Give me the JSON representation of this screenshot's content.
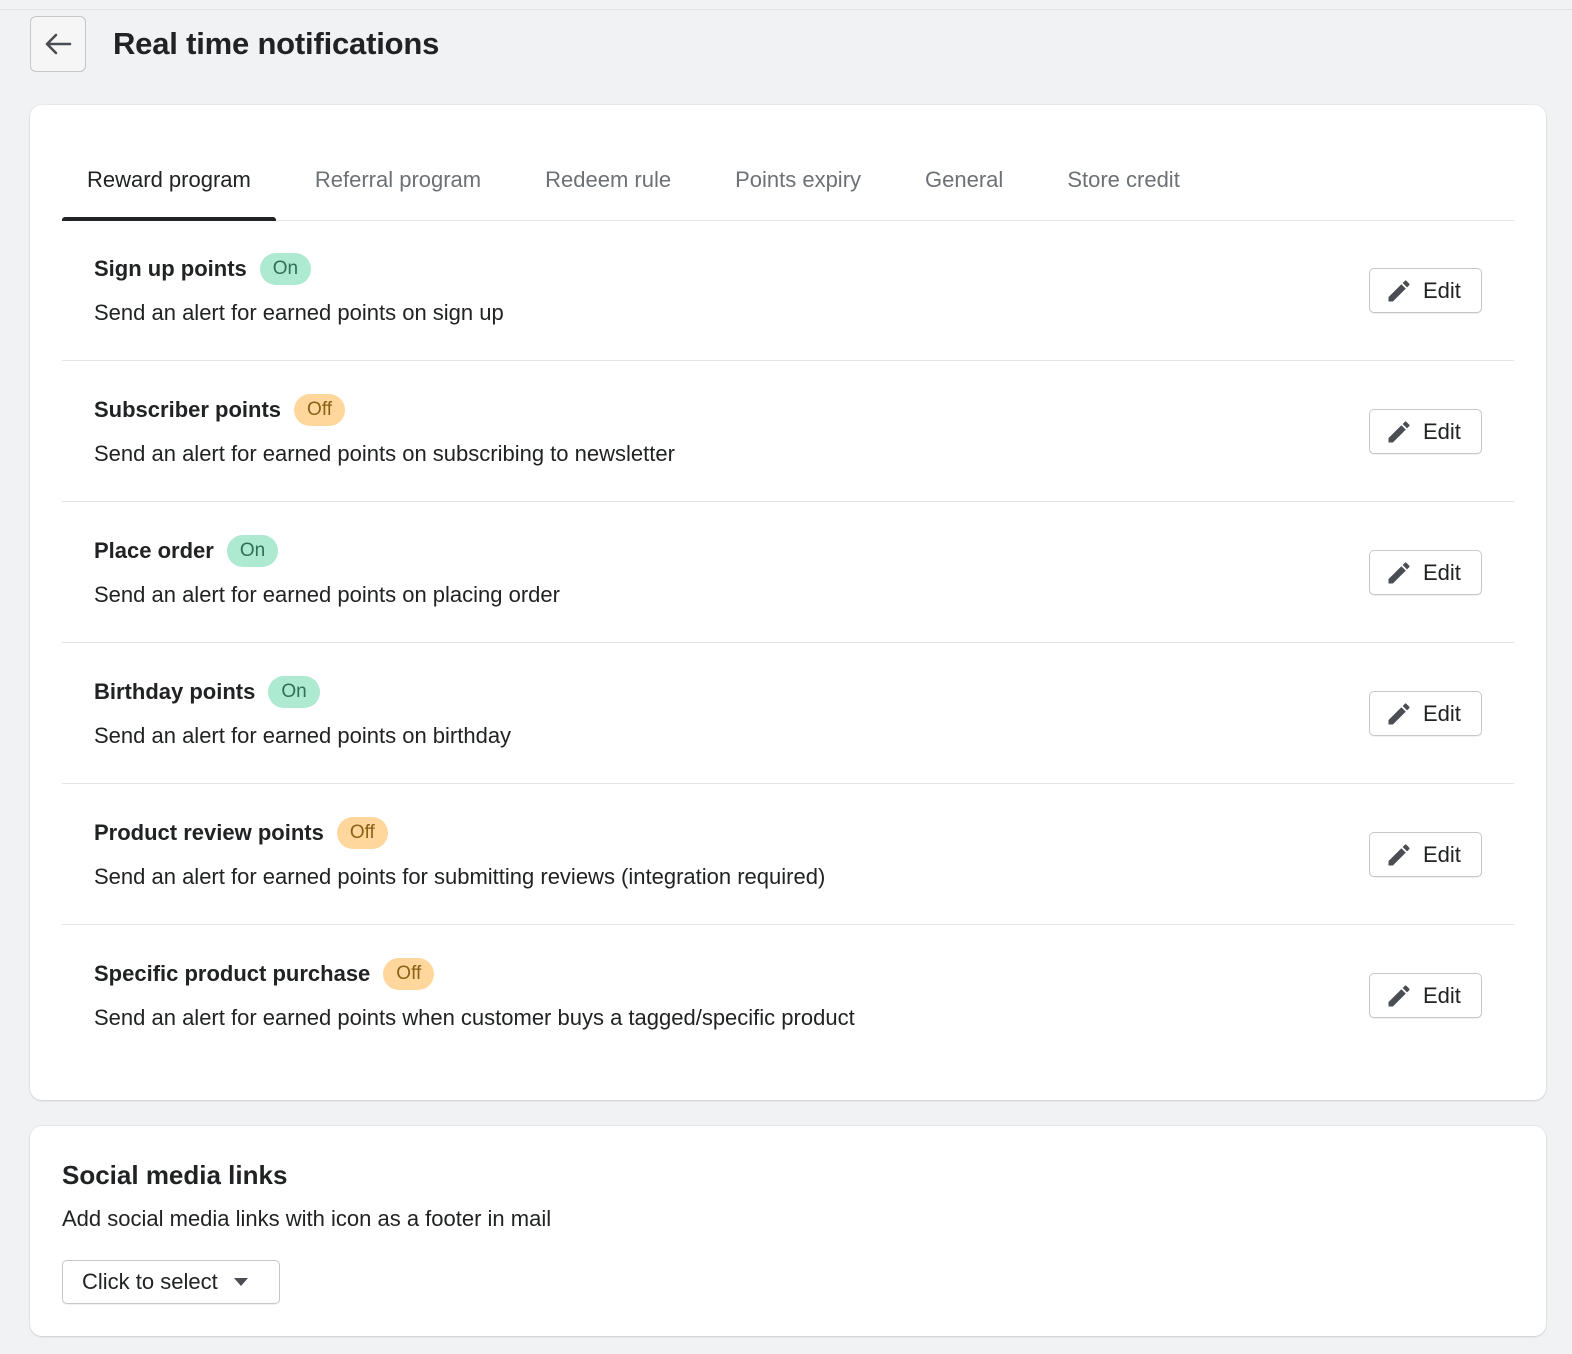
{
  "header": {
    "back_icon": "arrow-left-icon",
    "title": "Real time notifications"
  },
  "tabs": [
    {
      "label": "Reward program",
      "active": true
    },
    {
      "label": "Referral program",
      "active": false
    },
    {
      "label": "Redeem rule",
      "active": false
    },
    {
      "label": "Points expiry",
      "active": false
    },
    {
      "label": "General",
      "active": false
    },
    {
      "label": "Store credit",
      "active": false
    }
  ],
  "notifications": [
    {
      "title": "Sign up points",
      "status": "On",
      "description": "Send an alert for earned points on sign up",
      "edit_label": "Edit"
    },
    {
      "title": "Subscriber points",
      "status": "Off",
      "description": "Send an alert for earned points on subscribing to newsletter",
      "edit_label": "Edit"
    },
    {
      "title": "Place order",
      "status": "On",
      "description": "Send an alert for earned points on placing order",
      "edit_label": "Edit"
    },
    {
      "title": "Birthday points",
      "status": "On",
      "description": "Send an alert for earned points on birthday",
      "edit_label": "Edit"
    },
    {
      "title": "Product review points",
      "status": "Off",
      "description": "Send an alert for earned points for submitting reviews (integration required)",
      "edit_label": "Edit"
    },
    {
      "title": "Specific product purchase",
      "status": "Off",
      "description": "Send an alert for earned points when customer buys a tagged/specific product",
      "edit_label": "Edit"
    }
  ],
  "social": {
    "title": "Social media links",
    "description": "Add social media links with icon as a footer in mail",
    "select_label": "Click to select",
    "select_icon": "caret-down-icon"
  },
  "colors": {
    "background": "#f1f2f4",
    "badge_on_bg": "#aee9d1",
    "badge_on_text": "#2f6f58",
    "badge_off_bg": "#ffd79d",
    "badge_off_text": "#8a6116",
    "text": "#202223",
    "muted_text": "#6d7175"
  }
}
